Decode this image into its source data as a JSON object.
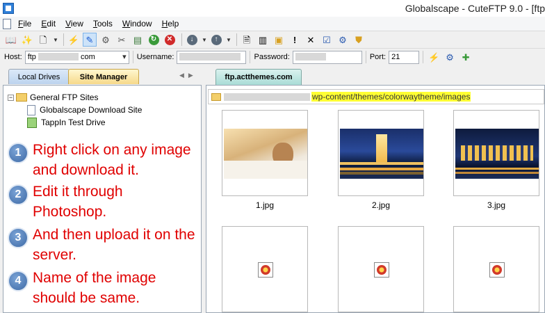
{
  "window": {
    "title": "Globalscape - CuteFTP 9.0 - [ftp"
  },
  "menu": [
    {
      "label": "File",
      "key": "F",
      "rest": "ile"
    },
    {
      "label": "Edit",
      "key": "E",
      "rest": "dit"
    },
    {
      "label": "View",
      "key": "V",
      "rest": "iew"
    },
    {
      "label": "Tools",
      "key": "T",
      "rest": "ools"
    },
    {
      "label": "Window",
      "key": "W",
      "rest": "indow"
    },
    {
      "label": "Help",
      "key": "H",
      "rest": "elp"
    }
  ],
  "quick_connect": {
    "host_label": "Host:",
    "host_value_prefix": "ftp",
    "host_value_suffix": "com",
    "username_label": "Username:",
    "password_label": "Password:",
    "port_label": "Port:",
    "port_value": "21"
  },
  "tabs": {
    "local_drives": "Local Drives",
    "site_manager": "Site Manager",
    "remote": "ftp.actthemes.com"
  },
  "tree": {
    "root": "General FTP Sites",
    "items": [
      "Globalscape Download Site",
      "TappIn Test Drive"
    ]
  },
  "annotations": [
    {
      "num": "1",
      "text": "Right click on any image and download it."
    },
    {
      "num": "2",
      "text": "Edit it through Photoshop."
    },
    {
      "num": "3",
      "text": "And then upload it on the server."
    },
    {
      "num": "4",
      "text": "Name of the image should be same."
    }
  ],
  "remote": {
    "path": "wp-content/themes/colorwaytheme/images",
    "files": [
      "1.jpg",
      "2.jpg",
      "3.jpg"
    ]
  },
  "colors": {
    "annotation_text": "#e00000",
    "path_highlight": "#ffff33"
  }
}
